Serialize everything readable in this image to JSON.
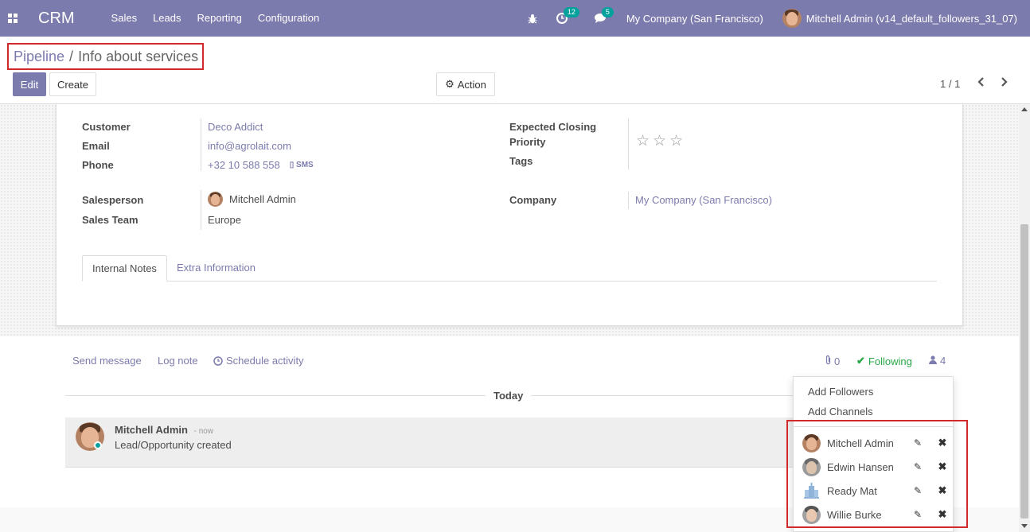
{
  "navbar": {
    "app_name": "CRM",
    "menu": [
      "Sales",
      "Leads",
      "Reporting",
      "Configuration"
    ],
    "activity_count": "12",
    "messages_count": "5",
    "company": "My Company (San Francisco)",
    "user": "Mitchell Admin (v14_default_followers_31_07)",
    "icons": [
      "apps-grid-icon",
      "bug-icon",
      "clock-icon",
      "chat-icon"
    ]
  },
  "breadcrumb": {
    "parent": "Pipeline",
    "separator": "/",
    "current": "Info about services"
  },
  "buttons": {
    "edit": "Edit",
    "create": "Create",
    "action": "Action"
  },
  "pager": {
    "value": "1 / 1"
  },
  "form": {
    "customer_label": "Customer",
    "customer_value": "Deco Addict",
    "email_label": "Email",
    "email_value": "info@agrolait.com",
    "phone_label": "Phone",
    "phone_value": "+32 10 588 558",
    "sms_label": "SMS",
    "salesperson_label": "Salesperson",
    "salesperson_value": "Mitchell Admin",
    "team_label": "Sales Team",
    "team_value": "Europe",
    "closing_label": "Expected Closing",
    "priority_label": "Priority",
    "priority_stars": 0,
    "priority_max": 3,
    "tags_label": "Tags",
    "company_label": "Company",
    "company_value": "My Company (San Francisco)"
  },
  "tabs": {
    "internal_notes": "Internal Notes",
    "extra_info": "Extra Information"
  },
  "chatter": {
    "send_message": "Send message",
    "log_note": "Log note",
    "schedule_activity": "Schedule activity",
    "attachments_count": "0",
    "following": "Following",
    "followers_count": "4",
    "date_separator": "Today",
    "message": {
      "author": "Mitchell Admin",
      "date": "- now",
      "body": "Lead/Opportunity created"
    }
  },
  "followers_dropdown": {
    "add_followers": "Add Followers",
    "add_channels": "Add Channels",
    "followers": [
      {
        "name": "Mitchell Admin"
      },
      {
        "name": "Edwin Hansen"
      },
      {
        "name": "Ready Mat"
      },
      {
        "name": "Willie Burke"
      }
    ]
  },
  "colors": {
    "brand": "#7c7bad",
    "highlight": "#d12a2a",
    "following": "#28a745",
    "badge": "#00a09d"
  }
}
